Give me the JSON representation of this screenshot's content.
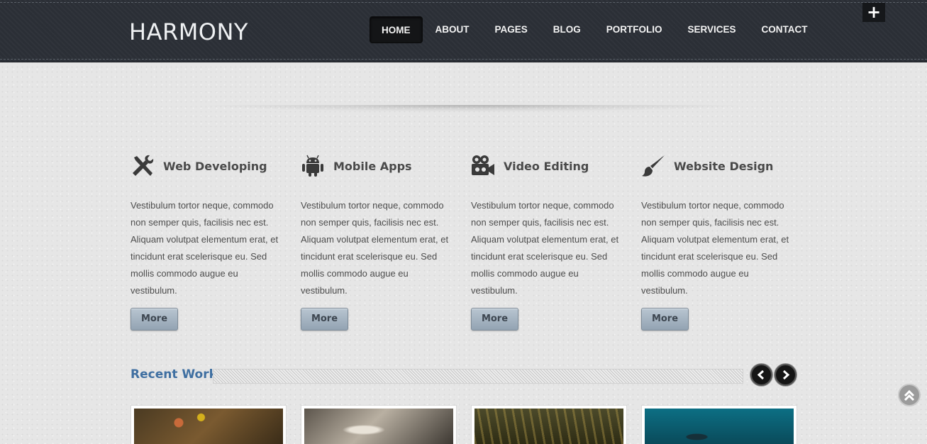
{
  "header": {
    "logo": "HARMONY",
    "nav": [
      "HOME",
      "ABOUT",
      "PAGES",
      "BLOG",
      "PORTFOLIO",
      "SERVICES",
      "CONTACT"
    ],
    "plus_label": "+"
  },
  "services": [
    {
      "title": "Web Developing",
      "icon": "tools-icon",
      "text": "Vestibulum tortor neque, commodo non semper quis, facilisis nec est. Aliquam volutpat elementum erat, et tincidunt erat scelerisque eu. Sed mollis commodo augue eu vestibulum.",
      "button": "More"
    },
    {
      "title": "Mobile Apps",
      "icon": "android-icon",
      "text": "Vestibulum tortor neque, commodo non semper quis, facilisis nec est. Aliquam volutpat elementum erat, et tincidunt erat scelerisque eu. Sed mollis commodo augue eu vestibulum.",
      "button": "More"
    },
    {
      "title": "Video Editing",
      "icon": "video-camera-icon",
      "text": "Vestibulum tortor neque, commodo non semper quis, facilisis nec est. Aliquam volutpat elementum erat, et tincidunt erat scelerisque eu. Sed mollis commodo augue eu vestibulum.",
      "button": "More"
    },
    {
      "title": "Website Design",
      "icon": "paintbrush-icon",
      "text": "Vestibulum tortor neque, commodo non semper quis, facilisis nec est. Aliquam volutpat elementum erat, et tincidunt erat scelerisque eu. Sed mollis commodo augue eu vestibulum.",
      "button": "More"
    }
  ],
  "recent": {
    "title": "Recent Work"
  },
  "colors": {
    "header_bg": "#2b2f36",
    "accent_blue": "#3f6fa1",
    "button_blue": "#a5b4c3"
  }
}
